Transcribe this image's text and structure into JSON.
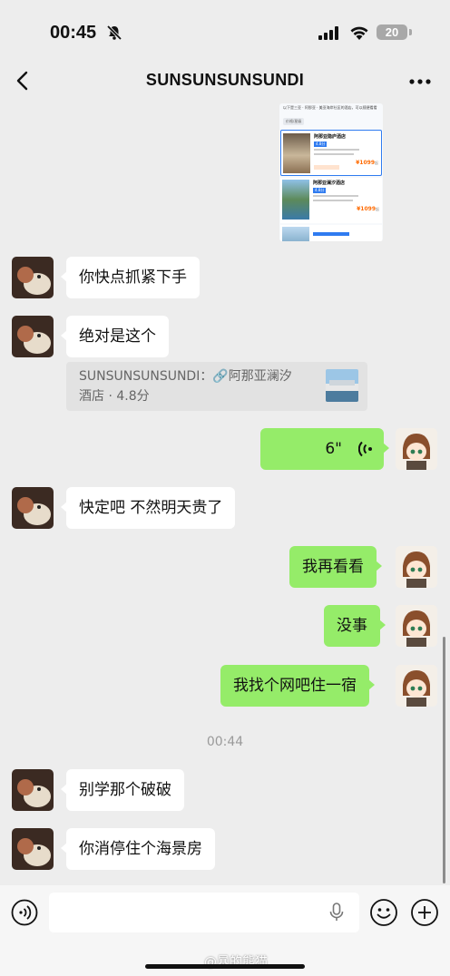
{
  "status_bar": {
    "time": "00:45",
    "battery": "20"
  },
  "header": {
    "title": "SUNSUNSUNSUNDI"
  },
  "shared_image": {
    "intro": "以下是三亚 · 阿那亚 · 美亚海岸社区的酒店，可以随便看看",
    "filter": "价格/星级",
    "hotels": [
      {
        "name": "阿那亚隐庐酒店",
        "score": "4.8分",
        "price": "¥1099",
        "price_suffix": "起"
      },
      {
        "name": "阿那亚澜汐酒店",
        "score": "4.8分",
        "price": "¥1099",
        "price_suffix": "起"
      }
    ]
  },
  "messages": [
    {
      "side": "left",
      "text": "你快点抓紧下手"
    },
    {
      "side": "left",
      "text": "绝对是这个"
    },
    {
      "side": "left",
      "quote": "SUNSUNSUNSUNDI：🔗阿那亚澜汐酒店 · 4.8分"
    },
    {
      "side": "right",
      "voice": "6\""
    },
    {
      "side": "left",
      "text": "快定吧 不然明天贵了"
    },
    {
      "side": "right",
      "text": "我再看看"
    },
    {
      "side": "right",
      "text": "没事"
    },
    {
      "side": "right",
      "text": "我找个网吧住一宿"
    },
    {
      "timestamp": "00:44"
    },
    {
      "side": "left",
      "text": "别学那个破破"
    },
    {
      "side": "left",
      "text": "你消停住个海景房"
    }
  ],
  "input": {
    "placeholder": ""
  },
  "watermark": "@暴的熊猫",
  "icons": [
    "bell-slash-icon",
    "signal-icon",
    "wifi-icon",
    "back-chevron-icon",
    "more-dots-icon",
    "voice-wave-icon",
    "mic-icon",
    "emoji-icon",
    "plus-icon"
  ],
  "colors": {
    "sent_bubble": "#95ec69",
    "received_bubble": "#ffffff",
    "background": "#ededed"
  }
}
